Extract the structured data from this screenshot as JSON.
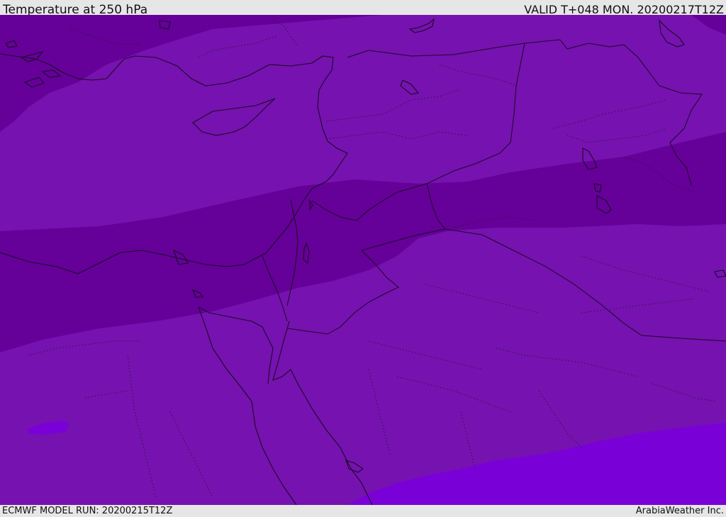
{
  "header": {
    "title": "Temperature at 250 hPa",
    "valid": "VALID T+048 MON. 20200217T12Z"
  },
  "footer": {
    "model_run": "ECMWF MODEL RUN: 20200215T12Z",
    "credit": "ArabiaWeather Inc."
  },
  "colors": {
    "band_cold": "#650099",
    "band_mid": "#7612b0",
    "band_warm": "#7a00d8",
    "coast": "#1a0a22",
    "border": "#1a0a22"
  }
}
